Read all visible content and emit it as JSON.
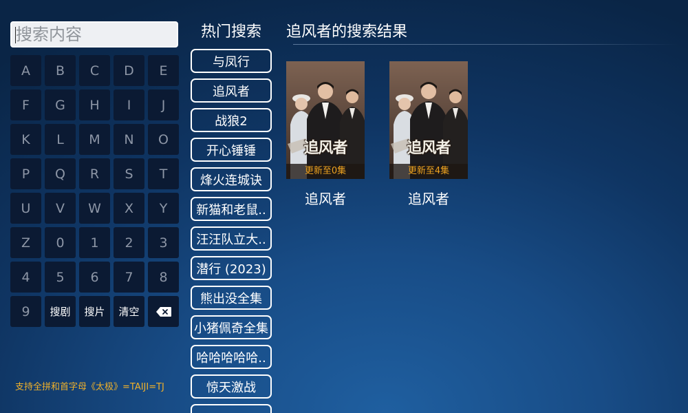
{
  "search": {
    "placeholder": "搜索内容"
  },
  "keyboard": {
    "keys": [
      "A",
      "B",
      "C",
      "D",
      "E",
      "F",
      "G",
      "H",
      "I",
      "J",
      "K",
      "L",
      "M",
      "N",
      "O",
      "P",
      "Q",
      "R",
      "S",
      "T",
      "U",
      "V",
      "W",
      "X",
      "Y",
      "Z",
      "0",
      "1",
      "2",
      "3",
      "4",
      "5",
      "6",
      "7",
      "8",
      "9"
    ],
    "search_drama_label": "搜剧",
    "search_movie_label": "搜片",
    "clear_label": "清空",
    "backspace_icon": "backspace-icon"
  },
  "hint": "支持全拼和首字母《太极》=TAIJI=TJ",
  "hot_searches": {
    "title": "热门搜索",
    "items": [
      "与凤行",
      "追风者",
      "战狼2",
      "开心锤锤",
      "烽火连城诀",
      "新猫和老鼠..",
      "汪汪队立大..",
      "潜行 (2023)",
      "熊出没全集",
      "小猪佩奇全集",
      "哈哈哈哈哈..",
      "惊天激战"
    ]
  },
  "results": {
    "title": "追风者的搜索结果",
    "items": [
      {
        "name": "追风者",
        "poster_title": "追风者",
        "badge": "更新至0集"
      },
      {
        "name": "追风者",
        "poster_title": "追风者",
        "badge": "更新至4集"
      }
    ]
  },
  "colors": {
    "hint": "#f0b12a",
    "badge_text": "#f0a420",
    "key_bg": "#0b1a33",
    "key_text": "#8d96a6"
  }
}
